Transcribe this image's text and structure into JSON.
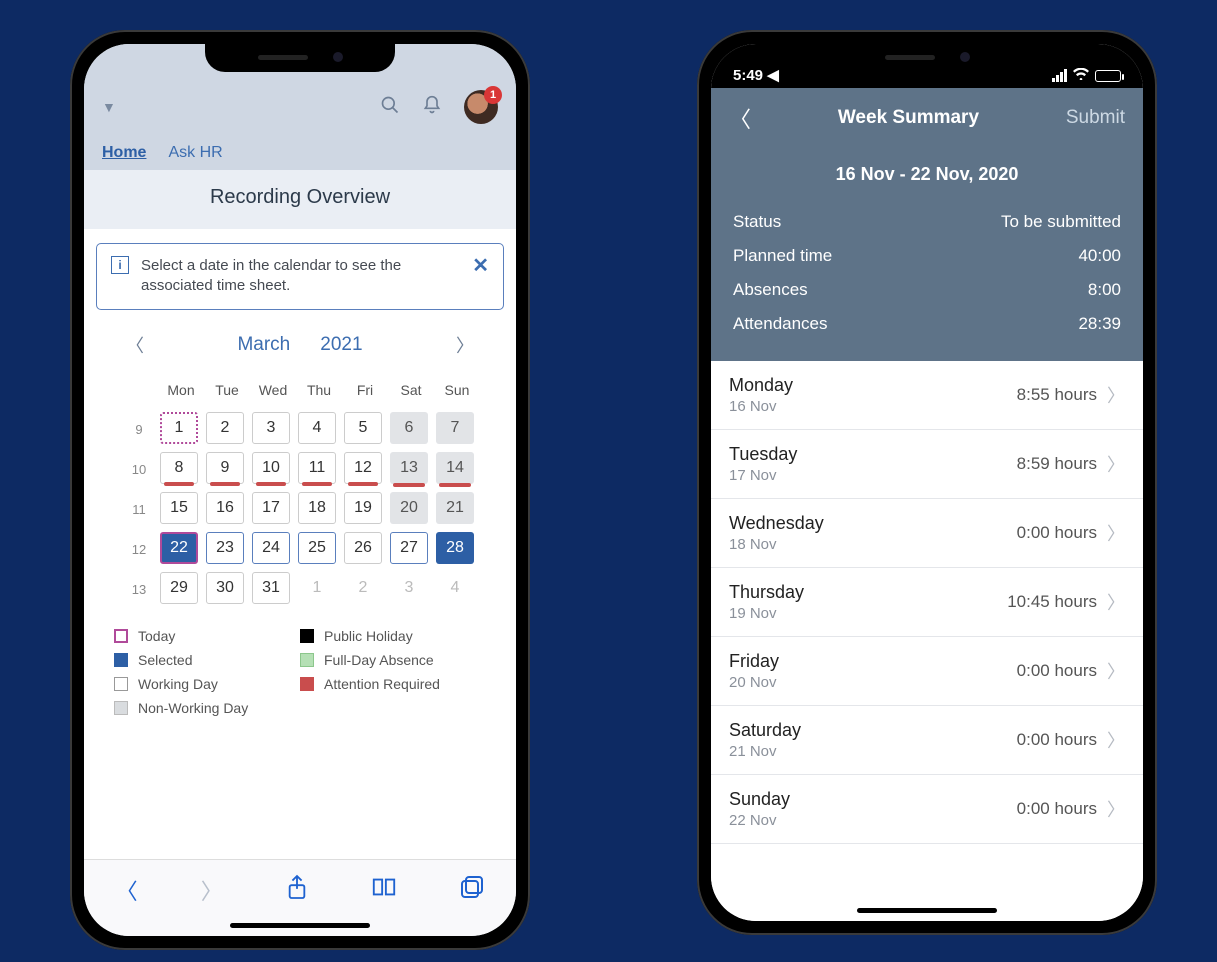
{
  "left": {
    "avatar_badge": "1",
    "tabs": {
      "home": "Home",
      "askhr": "Ask HR"
    },
    "page_title": "Recording Overview",
    "info_text": "Select a date in the calendar to see the associated time sheet.",
    "month": "March",
    "year": "2021",
    "dow": [
      "Mon",
      "Tue",
      "Wed",
      "Thu",
      "Fri",
      "Sat",
      "Sun"
    ],
    "weeks": [
      {
        "wk": "9",
        "days": [
          {
            "n": "1",
            "cls": "today"
          },
          {
            "n": "2",
            "cls": "wd"
          },
          {
            "n": "3",
            "cls": "wd"
          },
          {
            "n": "4",
            "cls": "wd"
          },
          {
            "n": "5",
            "cls": "wd"
          },
          {
            "n": "6",
            "cls": "nw"
          },
          {
            "n": "7",
            "cls": "nw"
          }
        ]
      },
      {
        "wk": "10",
        "days": [
          {
            "n": "8",
            "cls": "wd",
            "red": true
          },
          {
            "n": "9",
            "cls": "wd",
            "red": true
          },
          {
            "n": "10",
            "cls": "wd",
            "red": true
          },
          {
            "n": "11",
            "cls": "wd",
            "red": true
          },
          {
            "n": "12",
            "cls": "wd",
            "red": true
          },
          {
            "n": "13",
            "cls": "nw",
            "red": true
          },
          {
            "n": "14",
            "cls": "nw",
            "red": true
          }
        ]
      },
      {
        "wk": "11",
        "days": [
          {
            "n": "15",
            "cls": "wd"
          },
          {
            "n": "16",
            "cls": "wd"
          },
          {
            "n": "17",
            "cls": "wd"
          },
          {
            "n": "18",
            "cls": "wd"
          },
          {
            "n": "19",
            "cls": "wd"
          },
          {
            "n": "20",
            "cls": "nw"
          },
          {
            "n": "21",
            "cls": "nw"
          }
        ]
      },
      {
        "wk": "12",
        "days": [
          {
            "n": "22",
            "cls": "sel"
          },
          {
            "n": "23",
            "cls": "bordered"
          },
          {
            "n": "24",
            "cls": "bordered"
          },
          {
            "n": "25",
            "cls": "bordered"
          },
          {
            "n": "26",
            "cls": "wd"
          },
          {
            "n": "27",
            "cls": "bordered"
          },
          {
            "n": "28",
            "cls": "sel-dark"
          }
        ]
      },
      {
        "wk": "13",
        "days": [
          {
            "n": "29",
            "cls": "wd"
          },
          {
            "n": "30",
            "cls": "wd"
          },
          {
            "n": "31",
            "cls": "wd"
          },
          {
            "n": "1",
            "cls": "muted"
          },
          {
            "n": "2",
            "cls": "muted"
          },
          {
            "n": "3",
            "cls": "muted"
          },
          {
            "n": "4",
            "cls": "muted"
          }
        ]
      }
    ],
    "legend": {
      "today": "Today",
      "selected": "Selected",
      "working": "Working Day",
      "nonworking": "Non-Working Day",
      "holiday": "Public Holiday",
      "absence": "Full-Day Absence",
      "attention": "Attention Required"
    }
  },
  "right": {
    "status_time": "5:49",
    "title": "Week Summary",
    "submit": "Submit",
    "range": "16 Nov - 22 Nov, 2020",
    "stats": {
      "status_label": "Status",
      "status_value": "To be submitted",
      "planned_label": "Planned time",
      "planned_value": "40:00",
      "absences_label": "Absences",
      "absences_value": "8:00",
      "attend_label": "Attendances",
      "attend_value": "28:39"
    },
    "days": [
      {
        "day": "Monday",
        "date": "16 Nov",
        "hours": "8:55 hours"
      },
      {
        "day": "Tuesday",
        "date": "17 Nov",
        "hours": "8:59 hours"
      },
      {
        "day": "Wednesday",
        "date": "18 Nov",
        "hours": "0:00 hours"
      },
      {
        "day": "Thursday",
        "date": "19 Nov",
        "hours": "10:45 hours"
      },
      {
        "day": "Friday",
        "date": "20 Nov",
        "hours": "0:00 hours"
      },
      {
        "day": "Saturday",
        "date": "21 Nov",
        "hours": "0:00 hours"
      },
      {
        "day": "Sunday",
        "date": "22 Nov",
        "hours": "0:00 hours"
      }
    ]
  }
}
